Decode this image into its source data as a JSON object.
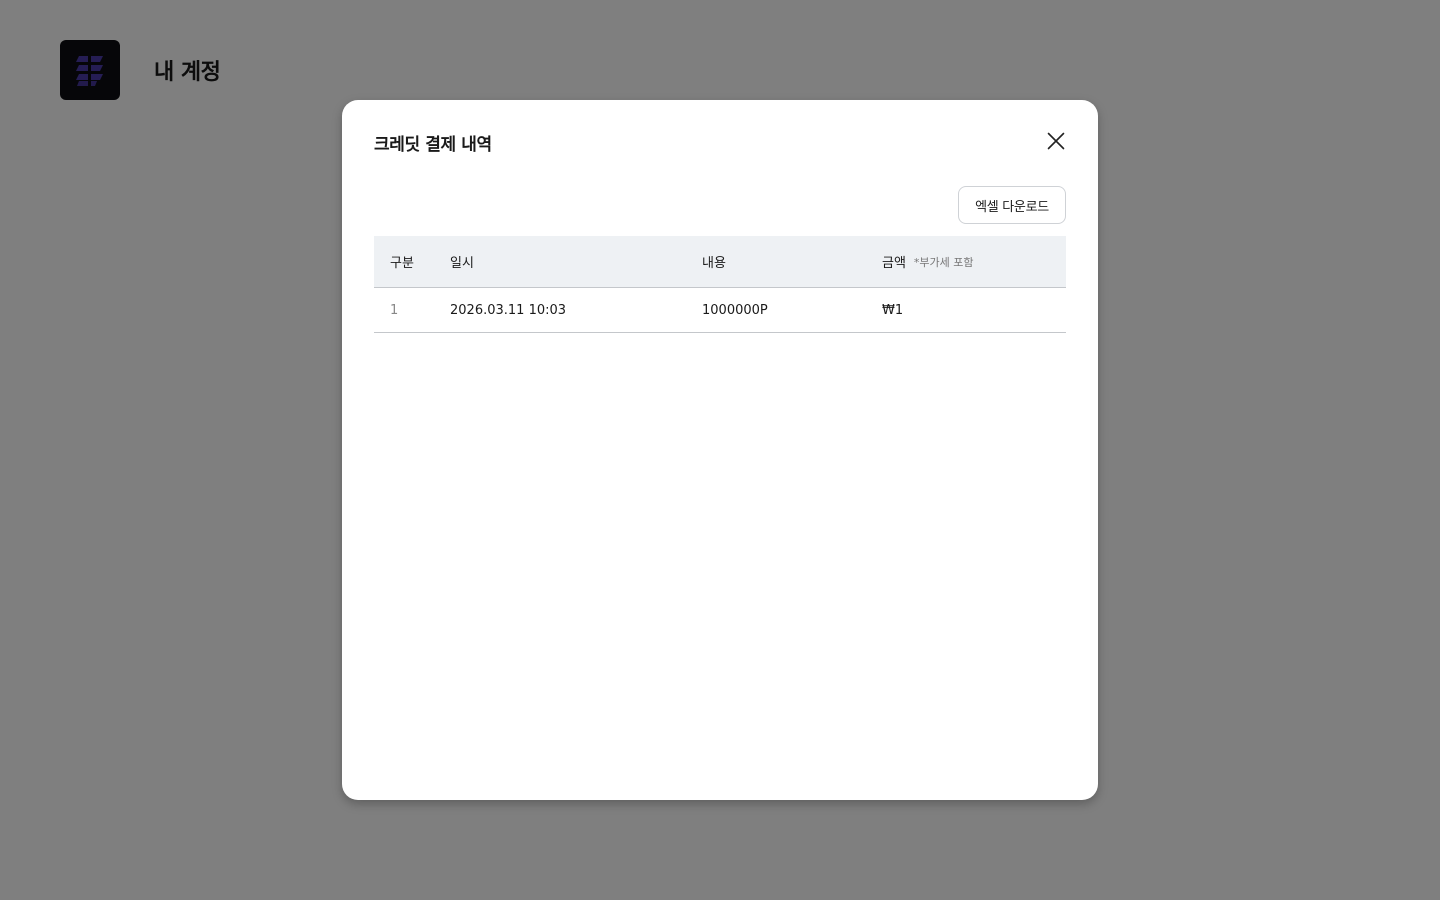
{
  "page": {
    "title": "내 계정",
    "logo_icon": "app-logo-icon"
  },
  "modal": {
    "title": "크레딧 결제 내역",
    "close_icon": "close-icon",
    "excel_download_label": "엑셀 다운로드",
    "table": {
      "headers": {
        "index": "구분",
        "datetime": "일시",
        "content": "내용",
        "amount": "금액",
        "amount_note": "*부가세 포함"
      },
      "rows": [
        {
          "index": "1",
          "datetime": "2026.03.11 10:03",
          "content": "1000000P",
          "amount": "₩1"
        }
      ]
    }
  },
  "colors": {
    "overlay": "#808080",
    "logo_bg": "#0d0d12",
    "logo_accent": "#4a3aa8",
    "table_header_bg": "#eef1f4"
  }
}
